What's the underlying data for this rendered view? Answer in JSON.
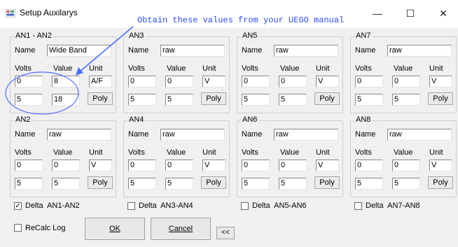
{
  "window": {
    "title": "Setup Auxilarys",
    "minimize": "—",
    "maximize": "☐",
    "close": "✕"
  },
  "annotation": "Obtain these values from your UEGO manual",
  "groups": [
    {
      "title": "AN1 - AN2",
      "name": "Wide Band",
      "v1": "0",
      "val1": "8",
      "unit": "A/F",
      "v2": "5",
      "val2": "18"
    },
    {
      "title": "AN3",
      "name": "raw",
      "v1": "0",
      "val1": "0",
      "unit": "V",
      "v2": "5",
      "val2": "5"
    },
    {
      "title": "AN5",
      "name": "raw",
      "v1": "0",
      "val1": "0",
      "unit": "V",
      "v2": "5",
      "val2": "5"
    },
    {
      "title": "AN7",
      "name": "raw",
      "v1": "0",
      "val1": "0",
      "unit": "V",
      "v2": "5",
      "val2": "5"
    },
    {
      "title": "AN2",
      "name": "raw",
      "v1": "0",
      "val1": "0",
      "unit": "V",
      "v2": "5",
      "val2": "5"
    },
    {
      "title": "AN4",
      "name": "raw",
      "v1": "0",
      "val1": "0",
      "unit": "V",
      "v2": "5",
      "val2": "5"
    },
    {
      "title": "AN6",
      "name": "raw",
      "v1": "0",
      "val1": "0",
      "unit": "V",
      "v2": "5",
      "val2": "5"
    },
    {
      "title": "AN8",
      "name": "raw",
      "v1": "0",
      "val1": "0",
      "unit": "V",
      "v2": "5",
      "val2": "5"
    }
  ],
  "labels": {
    "name": "Name",
    "volts": "Volts",
    "value": "Value",
    "unit": "Unit",
    "poly": "Poly"
  },
  "deltas": [
    {
      "label": "Delta  AN1-AN2",
      "checked": true
    },
    {
      "label": "Delta  AN3-AN4",
      "checked": false
    },
    {
      "label": "Delta  AN5-AN6",
      "checked": false
    },
    {
      "label": "Delta  AN7-AN8",
      "checked": false
    }
  ],
  "recalc": {
    "label": "ReCalc Log",
    "checked": false
  },
  "buttons": {
    "ok": "OK",
    "cancel": "Cancel",
    "back": "<<"
  },
  "colors": {
    "annotation": "#2b4bff",
    "highlight": "#4d6dff"
  }
}
